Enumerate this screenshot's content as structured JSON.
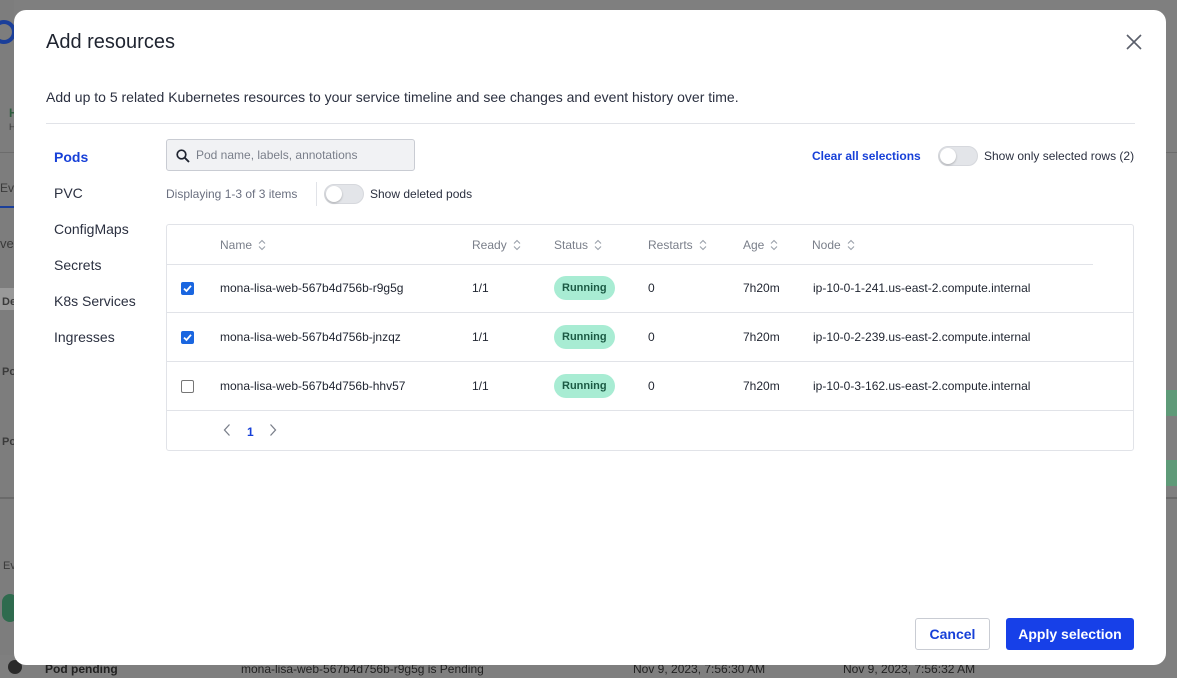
{
  "background": {
    "fragments": [
      "H",
      "H",
      "Ev",
      "ve",
      "De",
      "Po",
      "Po",
      "Ev"
    ],
    "bottom_row": {
      "name": "Pod pending",
      "message": "mona-lisa-web-567b4d756b-r9g5g is Pending",
      "time1": "Nov 9, 2023, 7:56:30 AM",
      "time2": "Nov 9, 2023, 7:56:32 AM"
    }
  },
  "modal": {
    "title": "Add resources",
    "description": "Add up to 5 related Kubernetes resources to your service timeline and see changes and event history over time.",
    "close_icon": "close-icon"
  },
  "side_nav": {
    "items": [
      {
        "label": "Pods",
        "active": true
      },
      {
        "label": "PVC",
        "active": false
      },
      {
        "label": "ConfigMaps",
        "active": false
      },
      {
        "label": "Secrets",
        "active": false
      },
      {
        "label": "K8s Services",
        "active": false
      },
      {
        "label": "Ingresses",
        "active": false
      }
    ]
  },
  "search": {
    "placeholder": "Pod name, labels, annotations",
    "value": "",
    "icon": "search-icon"
  },
  "toolbar": {
    "clear_label": "Clear all selections",
    "show_selected_label": "Show only selected rows (2)",
    "show_selected_on": false,
    "displaying": "Displaying 1-3 of 3 items",
    "show_deleted_label": "Show deleted pods",
    "show_deleted_on": false
  },
  "table": {
    "columns": [
      "Name",
      "Ready",
      "Status",
      "Restarts",
      "Age",
      "Node"
    ],
    "rows": [
      {
        "checked": true,
        "name": "mona-lisa-web-567b4d756b-r9g5g",
        "ready": "1/1",
        "status": "Running",
        "restarts": "0",
        "age": "7h20m",
        "node": "ip-10-0-1-241.us-east-2.compute.internal"
      },
      {
        "checked": true,
        "name": "mona-lisa-web-567b4d756b-jnzqz",
        "ready": "1/1",
        "status": "Running",
        "restarts": "0",
        "age": "7h20m",
        "node": "ip-10-0-2-239.us-east-2.compute.internal"
      },
      {
        "checked": false,
        "name": "mona-lisa-web-567b4d756b-hhv57",
        "ready": "1/1",
        "status": "Running",
        "restarts": "0",
        "age": "7h20m",
        "node": "ip-10-0-3-162.us-east-2.compute.internal"
      }
    ],
    "status_color": "#a8ecd3",
    "pagination": {
      "current_page": "1"
    }
  },
  "footer": {
    "cancel_label": "Cancel",
    "apply_label": "Apply selection"
  },
  "colors": {
    "accent": "#1740d8",
    "primary_button": "#1740e8",
    "checkbox_checked": "#1a66e0"
  }
}
